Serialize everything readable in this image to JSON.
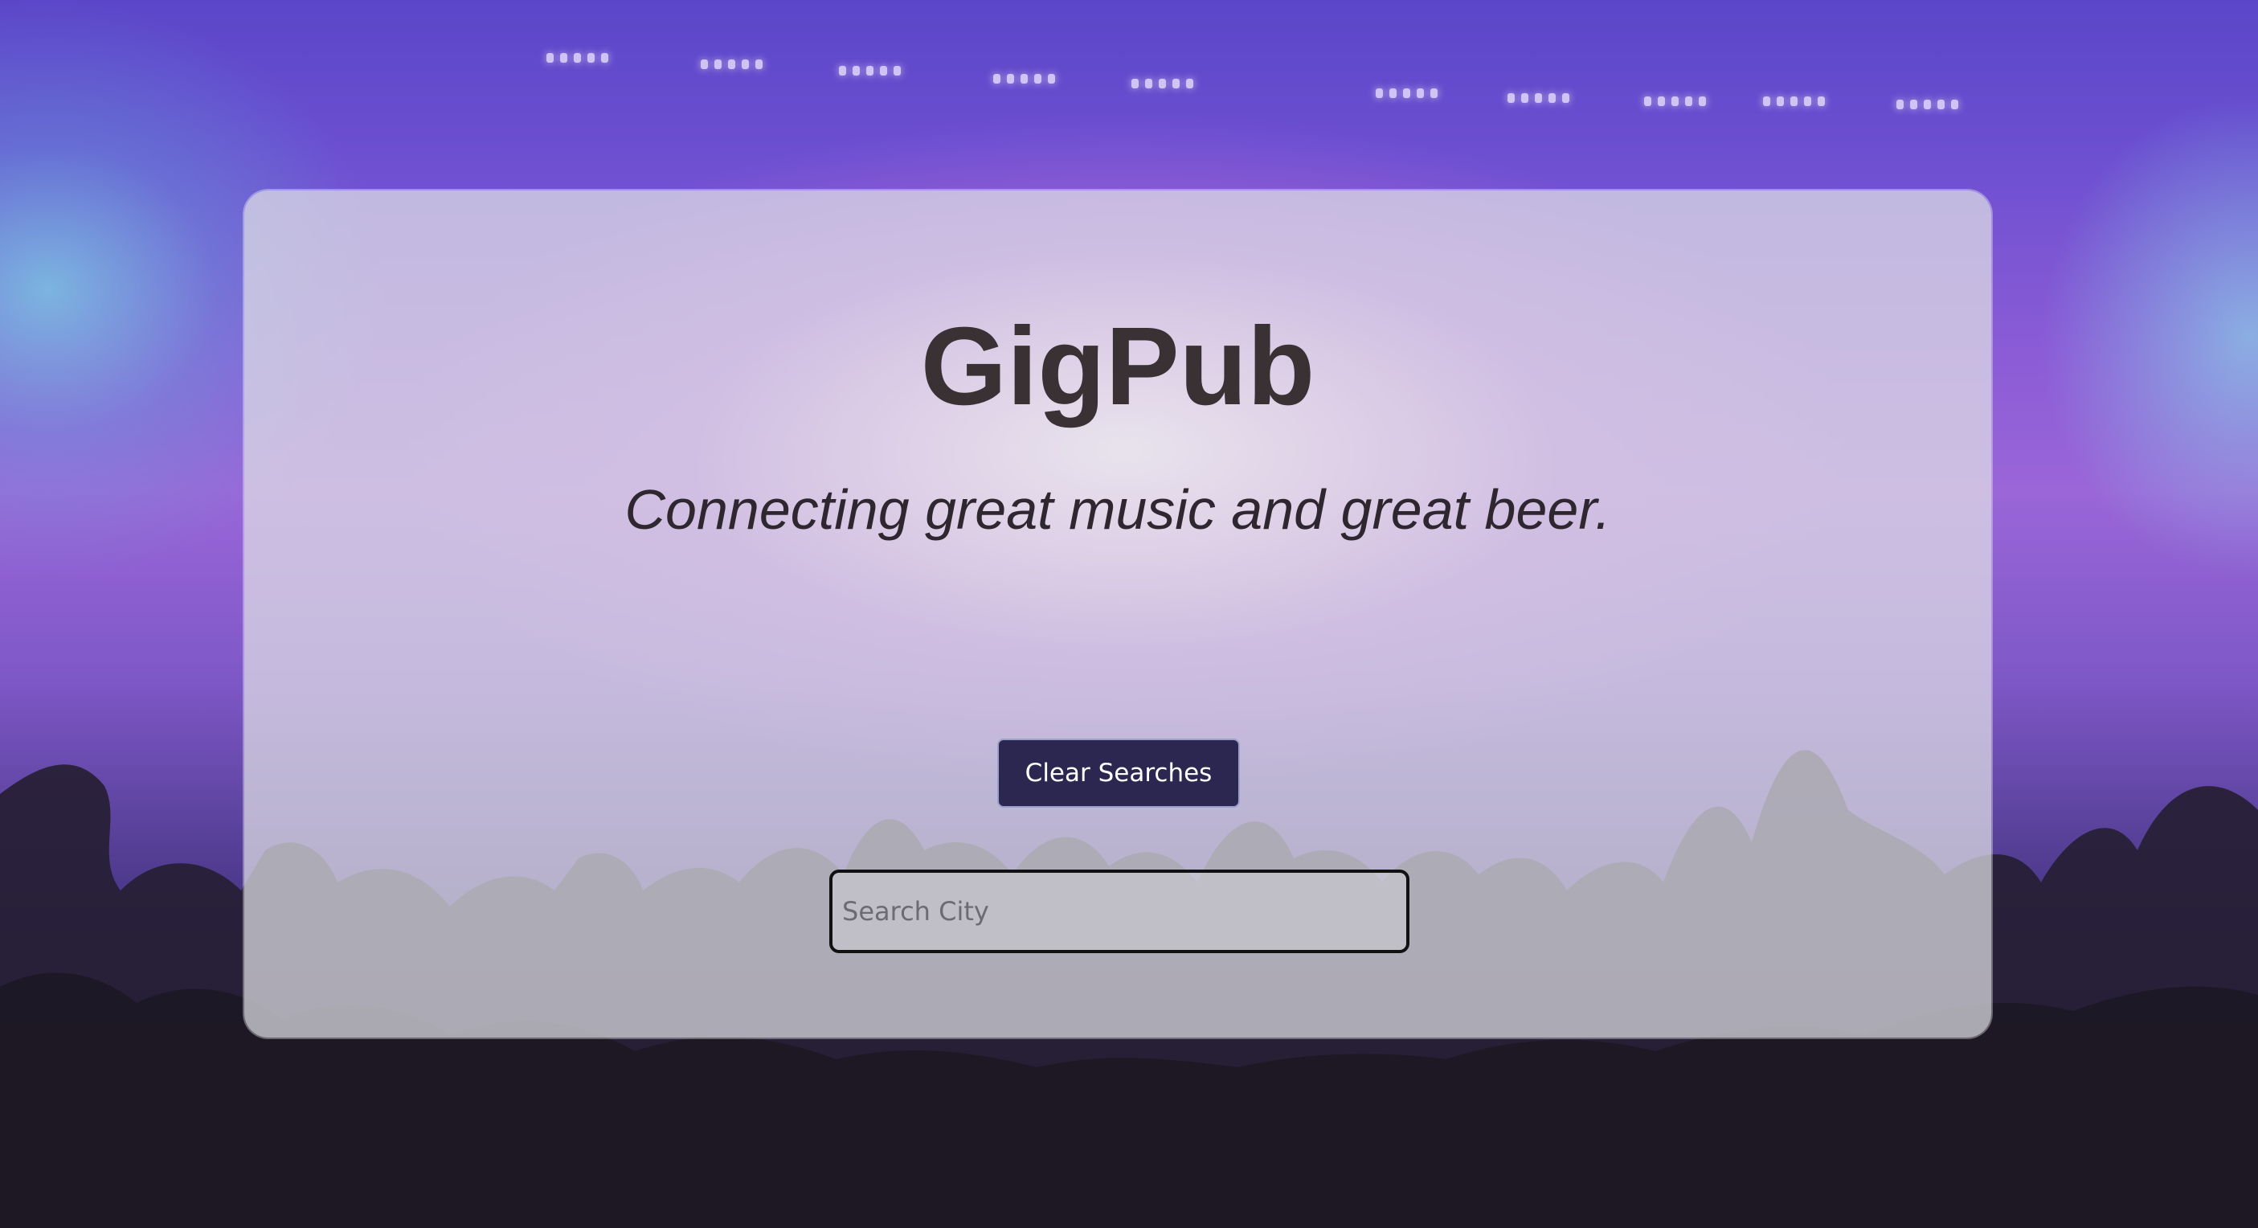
{
  "app": {
    "title": "GigPub",
    "tagline": "Connecting great music and great beer."
  },
  "controls": {
    "clear_label": "Clear Searches",
    "search_placeholder": "Search City",
    "search_value": ""
  },
  "colors": {
    "button_bg": "#2b2750",
    "title_text": "#3a3135",
    "card_bg": "rgba(225,225,230,0.72)"
  }
}
